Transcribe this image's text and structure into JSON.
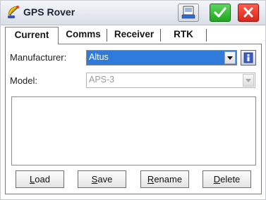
{
  "window": {
    "title": "GPS Rover"
  },
  "tabs": [
    {
      "label": "Current",
      "active": true
    },
    {
      "label": "Comms",
      "active": false
    },
    {
      "label": "Receiver",
      "active": false
    },
    {
      "label": "RTK",
      "active": false
    }
  ],
  "form": {
    "manufacturer": {
      "label": "Manufacturer:",
      "value": "Altus"
    },
    "model": {
      "label": "Model:",
      "value": "APS-3",
      "disabled": true
    }
  },
  "buttons": {
    "load": {
      "first": "L",
      "rest": "oad"
    },
    "save": {
      "first": "S",
      "rest": "ave"
    },
    "rename": {
      "first": "R",
      "rest": "ename"
    },
    "delete": {
      "first": "D",
      "rest": "elete"
    }
  },
  "icons": {
    "app": "satellite-dish-icon",
    "keyboard": "keyboard-icon",
    "ok": "checkmark-icon",
    "close": "close-icon",
    "info": "info-icon"
  },
  "colors": {
    "selection": "#2f7bdc",
    "ok": "#1fa71f",
    "close": "#d5271a",
    "disabled_text": "#9a9a9a"
  }
}
